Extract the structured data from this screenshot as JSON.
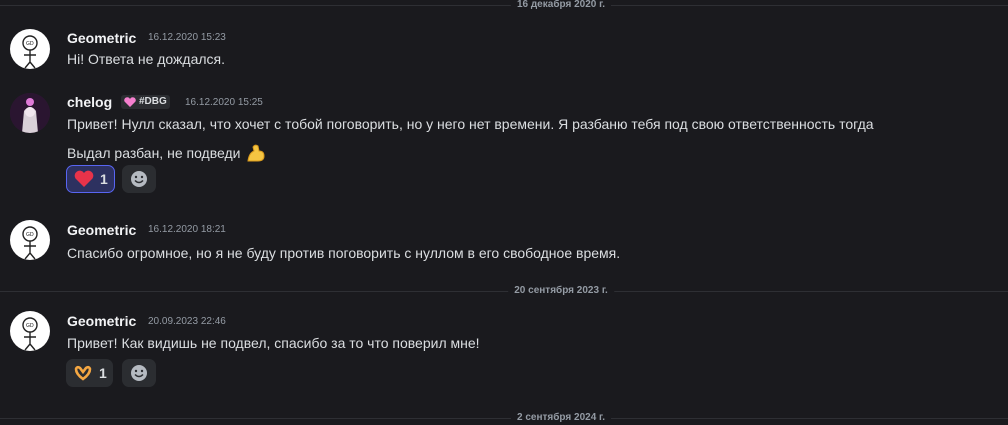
{
  "dividers": {
    "d1": "16 декабря 2020 г.",
    "d2": "20 сентября 2023 г.",
    "d3": "2 сентября 2024 г."
  },
  "messages": {
    "m1": {
      "author": "Geometric",
      "time": "16.12.2020 15:23",
      "text": "Hi! Ответа не дождался."
    },
    "m2": {
      "author": "chelog",
      "tag": "#DBG",
      "time": "16.12.2020 15:25",
      "text": "Привет! Нулл сказал, что хочет с тобой поговорить, но у него нет времени. Я разбаню тебя под свою ответственность тогда",
      "text2": "Выдал разбан, не подведи",
      "reaction": {
        "emoji": "heart",
        "count": "1"
      }
    },
    "m3": {
      "author": "Geometric",
      "time": "16.12.2020 18:21",
      "text": "Спасибо огромное, но я не буду против поговорить с нуллом в его свободное время."
    },
    "m4": {
      "author": "Geometric",
      "time": "20.09.2023 22:46",
      "text": "Привет! Как видишь не подвел, спасибо за то что поверил мне!",
      "reaction": {
        "emoji": "heart-hands",
        "count": "1"
      }
    }
  },
  "colors": {
    "background": "#1a1a1e",
    "accent": "#5865f2",
    "heart": "#e8334a"
  }
}
